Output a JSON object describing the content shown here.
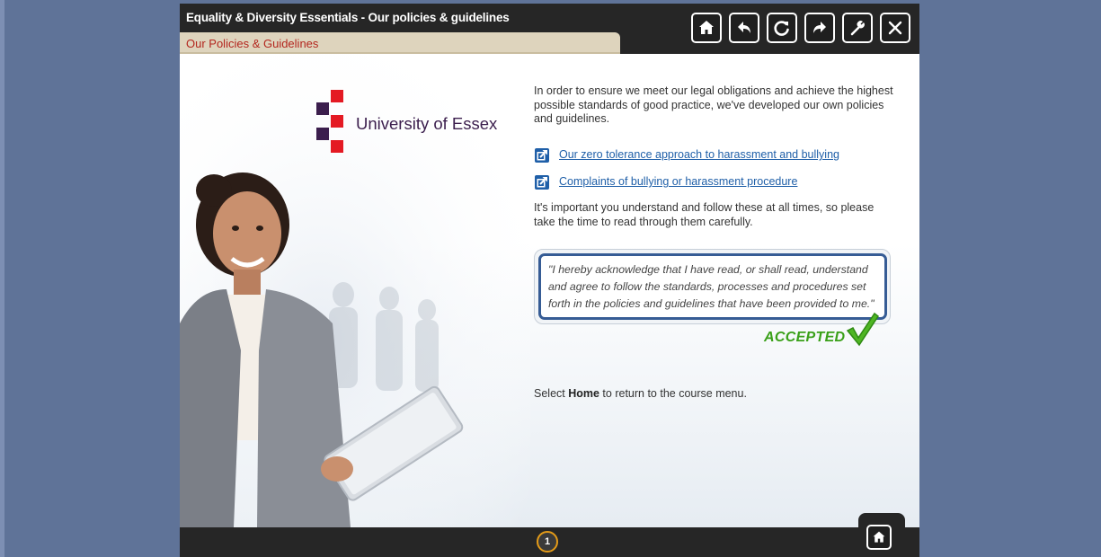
{
  "header": {
    "course_title": "Equality & Diversity Essentials - Our policies & guidelines",
    "section_tab": "Our Policies & Guidelines"
  },
  "toolbar": {
    "buttons": [
      "home-icon",
      "undo-icon",
      "reload-icon",
      "redo-icon",
      "wrench-icon",
      "close-icon"
    ]
  },
  "logo": {
    "text": "University of Essex",
    "colors": {
      "red": "#e41a23",
      "purple": "#3b1e4d"
    }
  },
  "content": {
    "intro": "In order to ensure we meet our legal obligations and achieve the highest possible standards of good practice, we've developed our own policies and guidelines.",
    "links": [
      {
        "label": "Our zero tolerance approach to harassment and bullying",
        "icon": "external-link-icon"
      },
      {
        "label": "Complaints of bullying or harassment procedure",
        "icon": "external-link-icon"
      }
    ],
    "instruction": "It's important you understand and follow these at all times, so please take the time to read through them carefully.",
    "acknowledgement": "\"I hereby acknowledge that I have read, or shall read, understand and agree to follow the standards, processes and procedures set forth in the policies and guidelines that have been provided to me.\"",
    "accepted_label": "ACCEPTED",
    "return_prefix": "Select ",
    "return_bold": "Home",
    "return_suffix": " to return to the course menu."
  },
  "footer": {
    "page_number": "1",
    "home_icon": "home-icon"
  },
  "colors": {
    "background": "#5f7398",
    "bar": "#262626",
    "tab": "#ded4bd",
    "tab_text": "#b3261e",
    "link": "#1f5fa8",
    "accepted": "#3aa019",
    "page_ring": "#e49b18"
  }
}
